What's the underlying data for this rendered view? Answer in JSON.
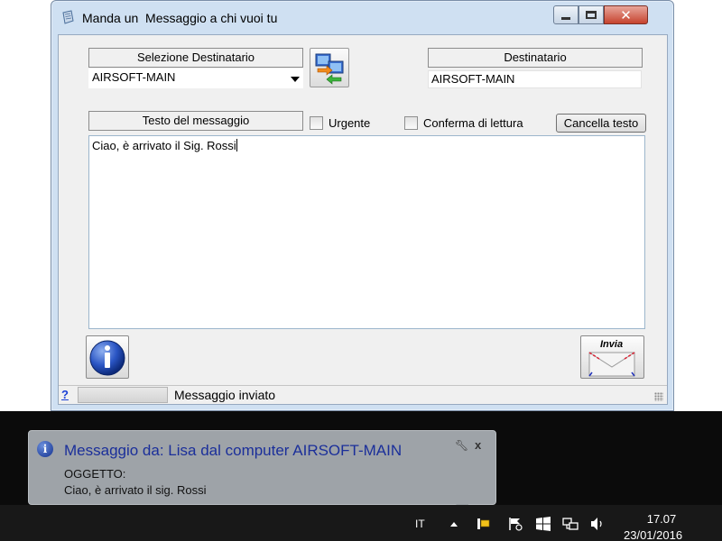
{
  "window": {
    "title": "Manda un  Messaggio a chi vuoi tu",
    "title_icon": "notepad-icon"
  },
  "form": {
    "recipient_select_header": "Selezione Destinatario",
    "recipient_select_value": "AIRSOFT-MAIN",
    "recipient_header": "Destinatario",
    "recipient_value": "AIRSOFT-MAIN",
    "message_header": "Testo del messaggio",
    "urgent_label": "Urgente",
    "urgent_checked": false,
    "read_receipt_label": "Conferma di lettura",
    "read_receipt_checked": false,
    "clear_button_label": "Cancella testo",
    "message_text": "Ciao, è arrivato il Sig. Rossi",
    "send_button_label": "Invia"
  },
  "statusbar": {
    "help_label": "?",
    "status_text": "Messaggio inviato"
  },
  "notification": {
    "title": "Messaggio da: Lisa dal computer AIRSOFT-MAIN",
    "subject_label": "OGGETTO:",
    "body": "Ciao, è arrivato il sig. Rossi",
    "close_label": "x"
  },
  "taskbar": {
    "language": "IT",
    "time": "17.07",
    "date": "23/01/2016"
  },
  "colors": {
    "window_frame": "#cfe0f2",
    "client_bg": "#f0f0f0",
    "close_button": "#c6432e",
    "balloon_bg": "#9ea3a8",
    "balloon_title": "#1b2f9a",
    "taskbar": "#181818"
  }
}
